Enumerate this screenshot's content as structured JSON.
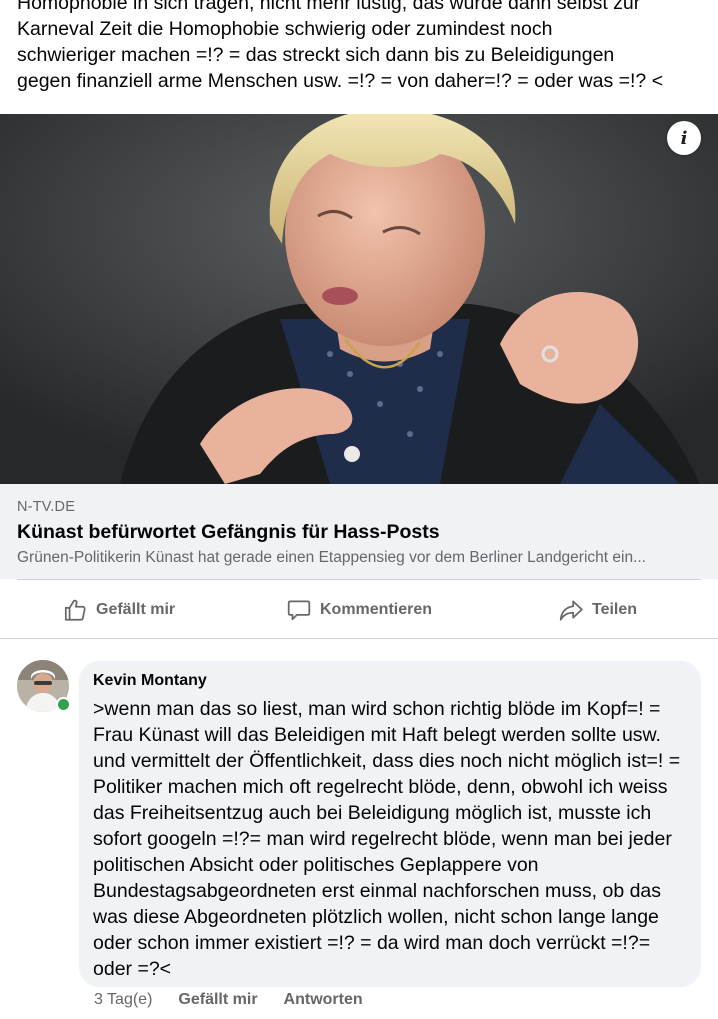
{
  "post": {
    "text_lines": [
      "Homophobie in sich tragen, nicht mehr lustig, das würde dann selbst zur",
      "Karneval Zeit die Homophobie schwierig oder zumindest noch",
      "schwieriger machen =!? = das streckt sich dann bis zu Beleidigungen",
      "gegen finanziell arme Menschen usw. =!? = von daher=!? = oder was =!? <"
    ]
  },
  "link": {
    "domain": "N-TV.DE",
    "title": "Künast befürwortet Gefängnis für Hass-Posts",
    "description": "Grünen-Politikerin Künast hat gerade einen Etappensieg vor dem Berliner Landgericht ein...",
    "info_icon": "i"
  },
  "actions": {
    "like": "Gefällt mir",
    "comment": "Kommentieren",
    "share": "Teilen"
  },
  "comment": {
    "author": "Kevin Montany",
    "body": ">wenn man das so liest, man wird schon richtig blöde im Kopf=! = Frau Künast will das Beleidigen mit Haft belegt werden sollte usw. und vermittelt der Öffentlichkeit, dass dies noch nicht möglich ist=! = Politiker machen mich oft  regelrecht blöde, denn, obwohl ich weiss das Freiheitsentzug auch bei Beleidigung möglich ist, musste ich sofort googeln =!?= man wird regelrecht blöde, wenn man bei jeder politischen Absicht oder politisches Geplappere von Bundestagsabgeordneten erst einmal nachforschen muss, ob das was diese Abgeordneten plötzlich wollen, nicht schon lange lange oder schon immer existiert =!? = da wird man doch verrückt =!?= oder =?<",
    "time": "3 Tag(e)",
    "like": "Gefällt mir",
    "reply": "Antworten"
  },
  "colors": {
    "secondary_text": "#65676b",
    "bubble_bg": "#f0f2f5",
    "online": "#31a24c"
  }
}
